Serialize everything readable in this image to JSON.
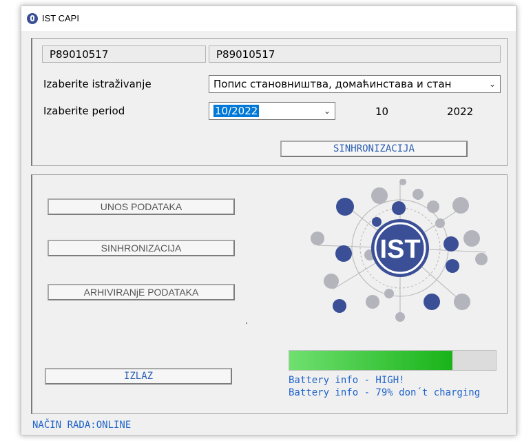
{
  "window": {
    "title": "IST CAPI"
  },
  "header": {
    "code_left": "P89010517",
    "code_right": "P89010517"
  },
  "survey": {
    "label": "Izaberite istraživanje",
    "selected": "Попис становништва, домаћинстава и стан"
  },
  "period": {
    "label": "Izaberite period",
    "selected": "10/2022",
    "month": "10",
    "year": "2022"
  },
  "sync_top_label": "SINHRONIZACIJA",
  "menu": {
    "entry": "UNOS PODATAKA",
    "sync": "SINHRONIZACIJA",
    "archive": "ARHIVIRANjE PODATAKA",
    "exit": "IZLAZ"
  },
  "logo": {
    "text": "IST",
    "icon": "ist-network-logo"
  },
  "battery": {
    "level": 0.79,
    "line1": "Battery info - HIGH!",
    "line2": "Battery info - 79% don´t charging"
  },
  "status": "NAČIN RADA:ONLINE",
  "colors": {
    "accent": "#3a4f96",
    "battery_fill": "#19b319",
    "info_text": "#1f63c9",
    "select_highlight": "#0078d7"
  }
}
